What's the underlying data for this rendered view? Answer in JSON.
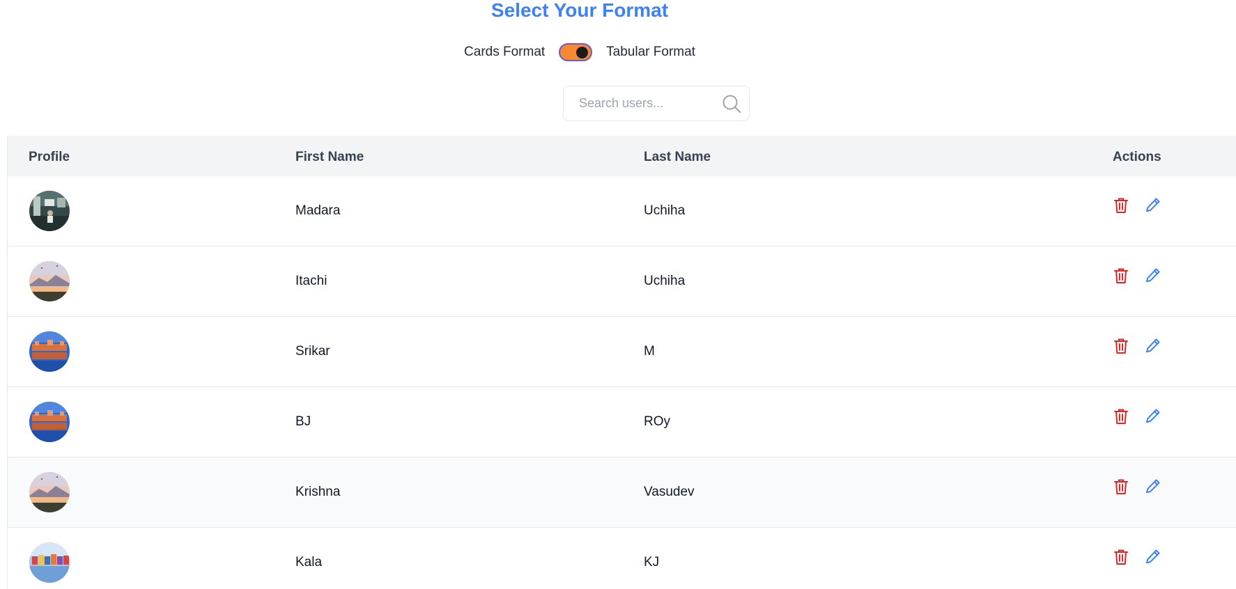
{
  "header": {
    "title": "Select Your Format",
    "toggle_left_label": "Cards Format",
    "toggle_right_label": "Tabular Format",
    "toggle_on": true
  },
  "search": {
    "placeholder": "Search users..."
  },
  "table": {
    "columns": [
      "Profile",
      "First Name",
      "Last Name",
      "Actions"
    ],
    "rows": [
      {
        "first": "Madara",
        "last": "Uchiha",
        "avatar": "office-photo"
      },
      {
        "first": "Itachi",
        "last": "Uchiha",
        "avatar": "sunset-lake-photo"
      },
      {
        "first": "Srikar",
        "last": "M",
        "avatar": "palace-reflection-photo"
      },
      {
        "first": "BJ",
        "last": "ROy",
        "avatar": "palace-reflection-photo"
      },
      {
        "first": "Krishna",
        "last": "Vasudev",
        "avatar": "sunset-lake-photo"
      },
      {
        "first": "Kala",
        "last": "KJ",
        "avatar": "waterfront-houses-photo"
      }
    ]
  },
  "colors": {
    "accent": "#3b82f6",
    "toggle": "#f58a33",
    "delete": "#dc2626",
    "edit": "#3b82f6"
  },
  "icons": [
    "search-icon",
    "trash-icon",
    "pencil-icon"
  ]
}
